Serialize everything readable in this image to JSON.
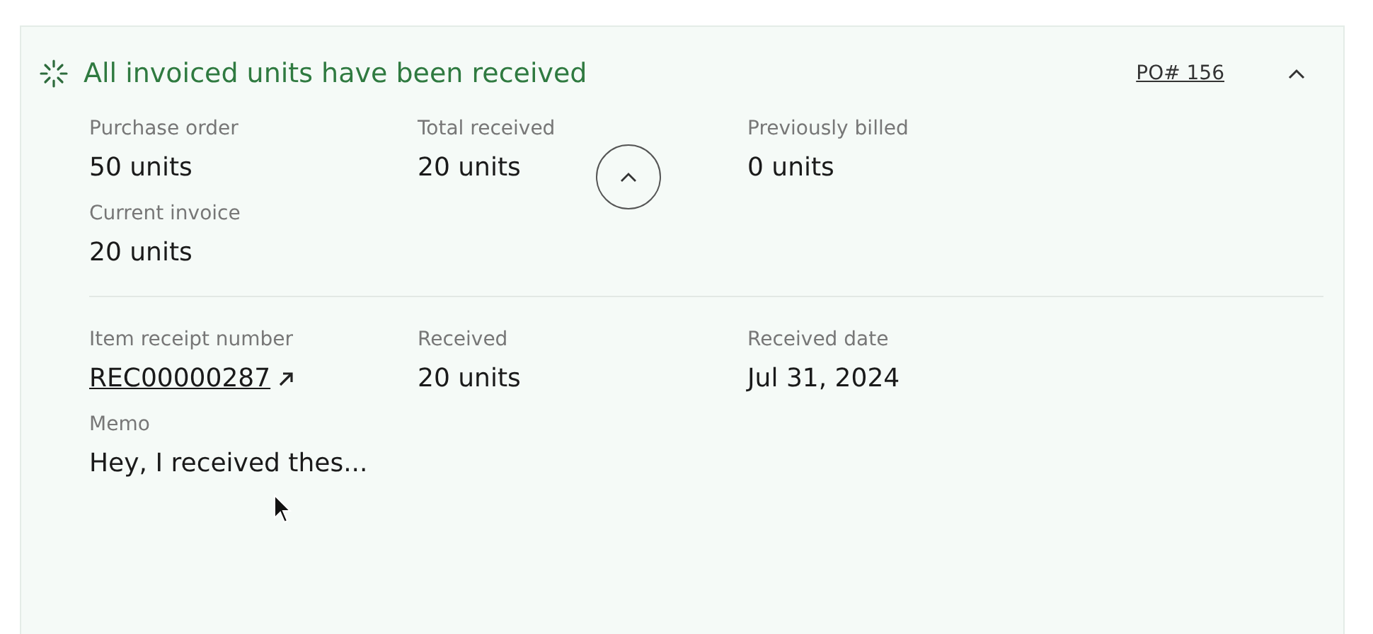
{
  "banner": {
    "title": "All invoiced units have been received",
    "po_link": "PO# 156",
    "expanded": true
  },
  "sections": [
    {
      "fields": [
        {
          "label": "Purchase order",
          "value": "50 units",
          "kind": "text"
        },
        {
          "label": "Total received",
          "value": "20 units",
          "kind": "text"
        },
        {
          "label": "Previously billed",
          "value": "0 units",
          "kind": "text"
        },
        {
          "label": "Current invoice",
          "value": "20 units",
          "kind": "text"
        }
      ]
    },
    {
      "fields": [
        {
          "label": "Item receipt number",
          "value": "REC00000287",
          "kind": "link"
        },
        {
          "label": "Received",
          "value": "20 units",
          "kind": "text"
        },
        {
          "label": "Received date",
          "value": "Jul 31, 2024",
          "kind": "text"
        },
        {
          "label": "Memo",
          "value": "Hey, I received thes...",
          "kind": "text"
        }
      ]
    }
  ]
}
